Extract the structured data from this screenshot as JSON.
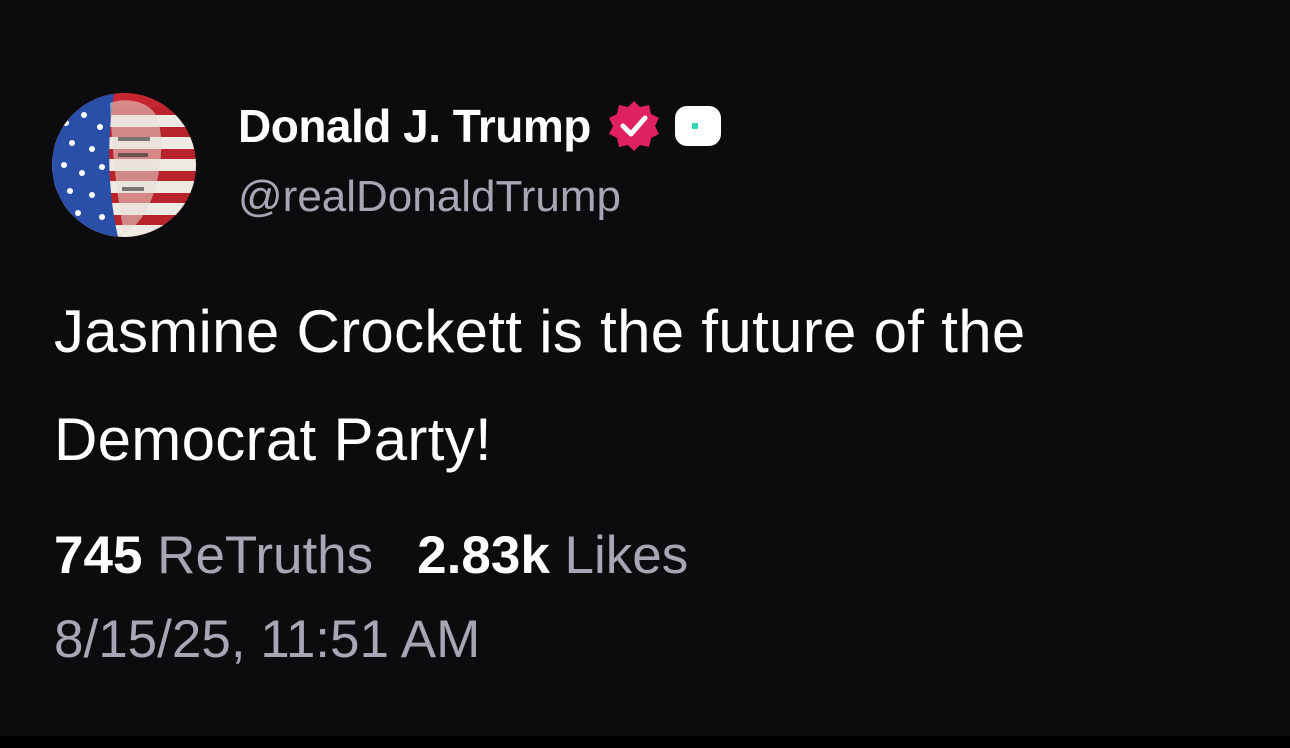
{
  "post": {
    "author": {
      "display_name": "Donald J. Trump",
      "handle": "@realDonaldTrump",
      "avatar_icon": "flag-portrait-avatar",
      "verified_icon": "verified-check-icon",
      "badge_icon": "affiliate-badge-icon"
    },
    "text": "Jasmine Crockett is the future of the Democrat Party!",
    "stats": {
      "retruths_count": "745",
      "retruths_label": "ReTruths",
      "likes_count": "2.83k",
      "likes_label": "Likes"
    },
    "timestamp": "8/15/25, 11:51 AM"
  },
  "colors": {
    "background": "#0c0b0d",
    "text": "#ffffff",
    "muted": "#a8a5b4",
    "verified": "#e0215f",
    "badge_dot": "#2fd4b4"
  }
}
